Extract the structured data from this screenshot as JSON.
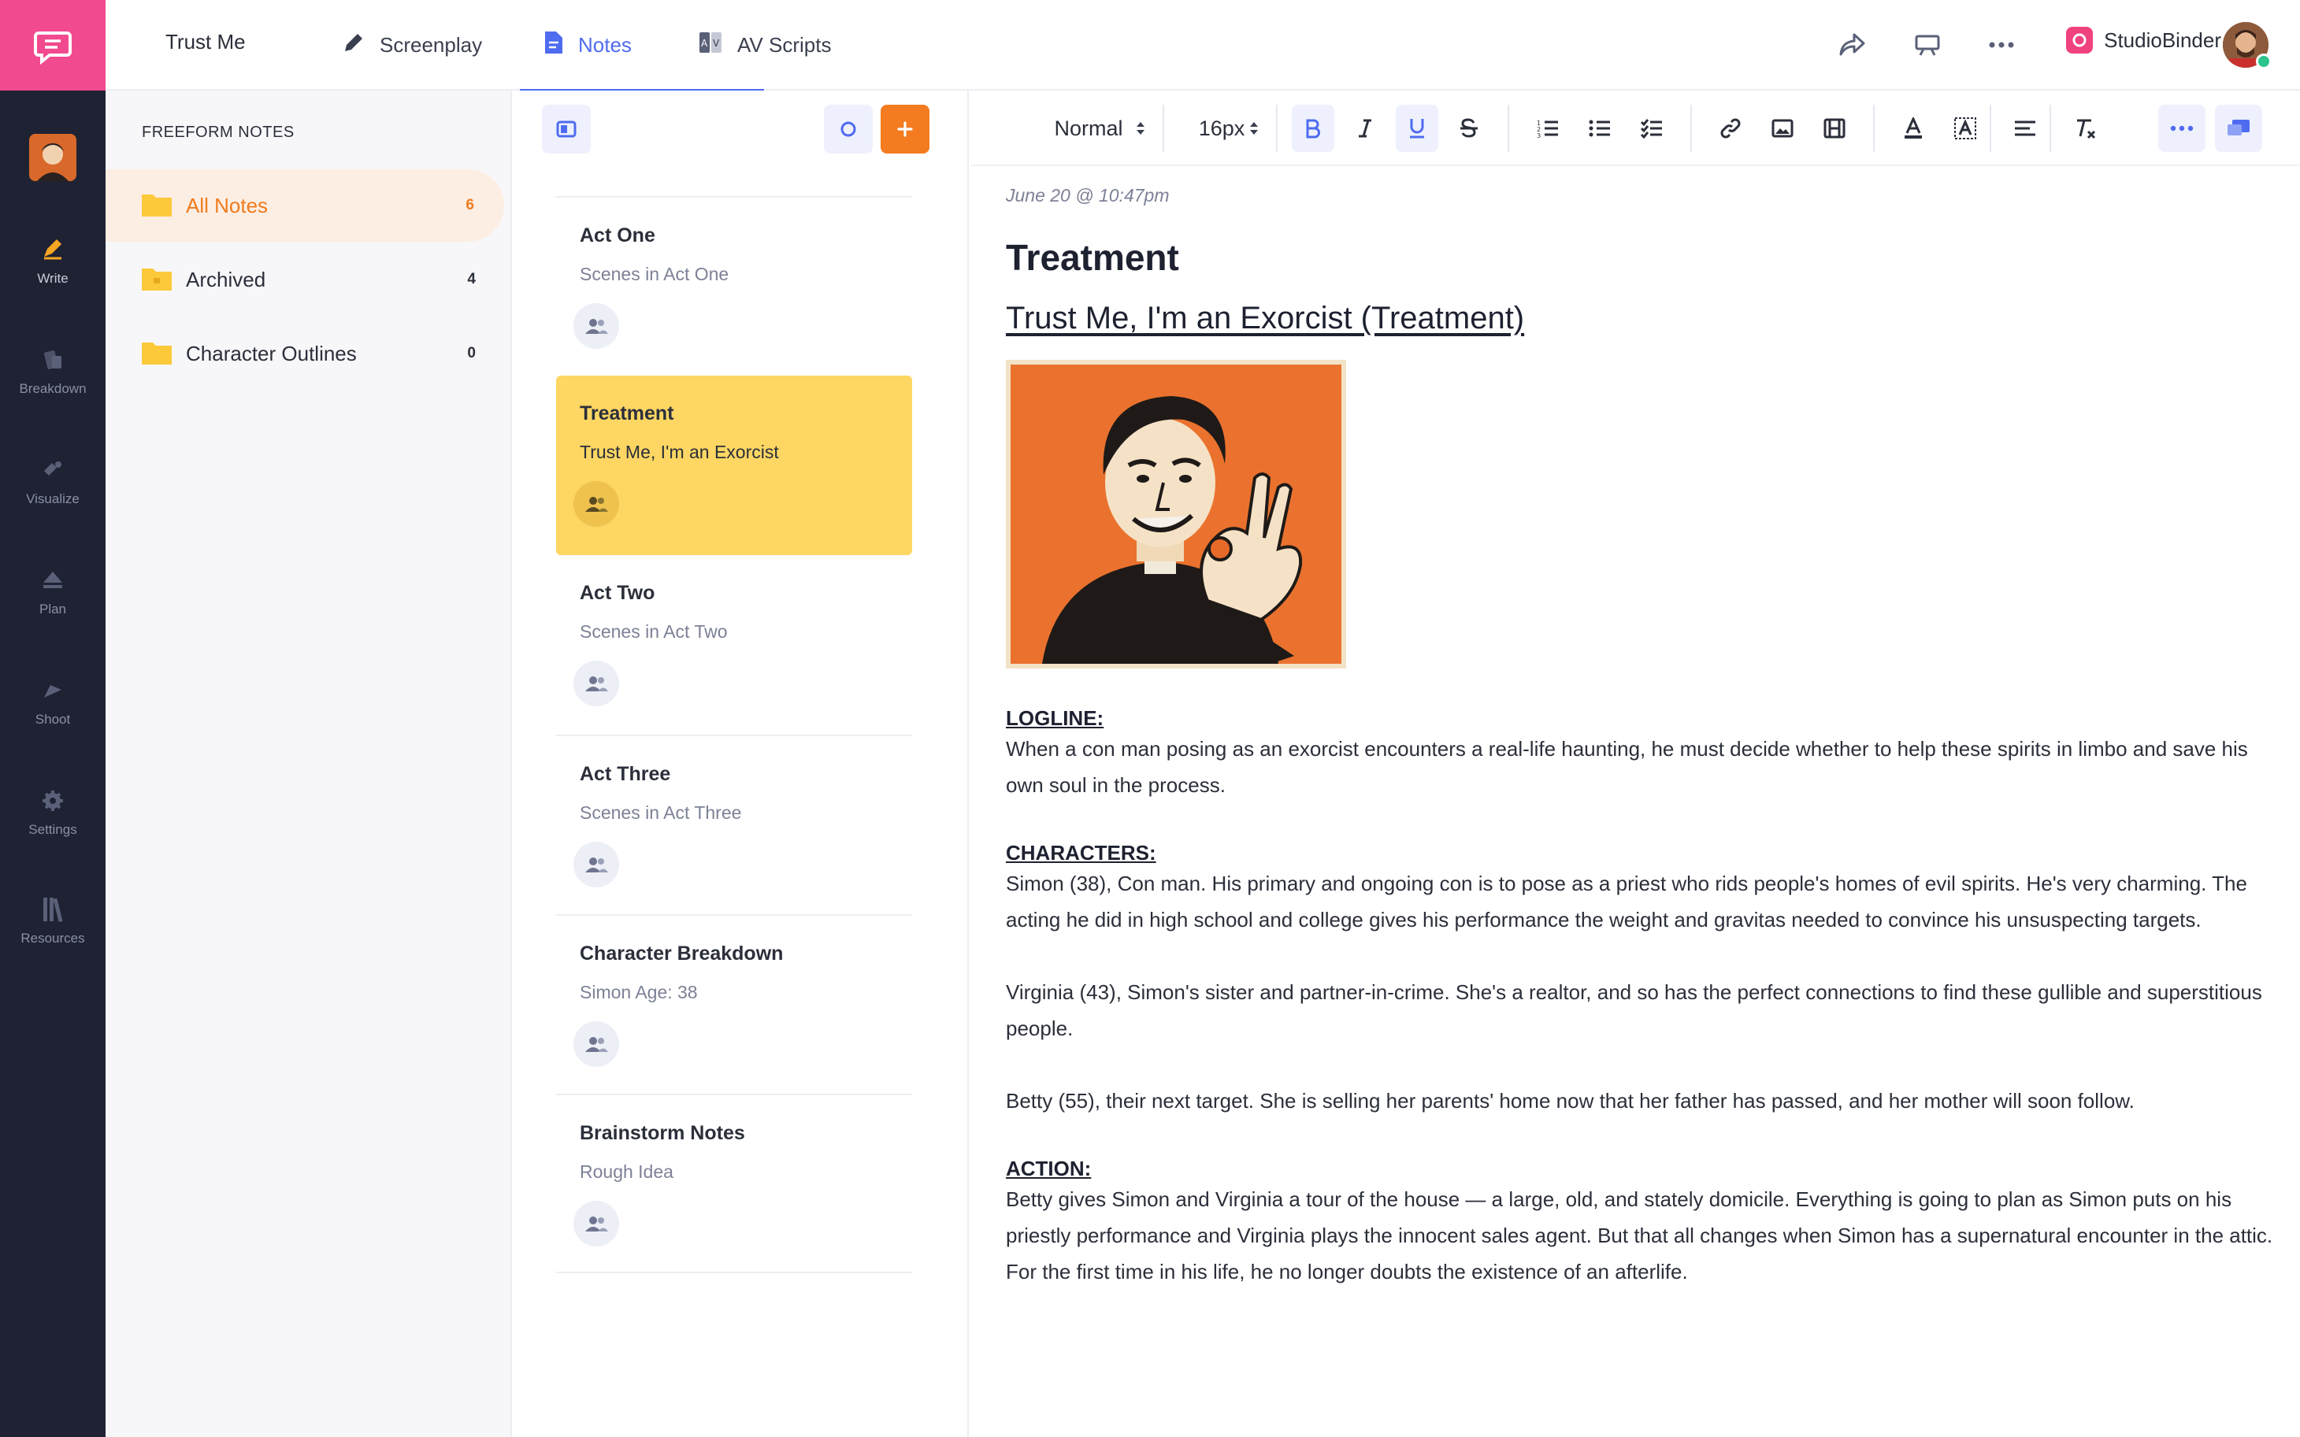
{
  "app": {
    "project_title": "Trust Me",
    "brand_name": "StudioBinder",
    "accent_color": "#4f6bf0",
    "logo_color": "#f24a8e"
  },
  "rail": {
    "items": [
      {
        "label": "Write",
        "icon": "pen-icon"
      },
      {
        "label": "Breakdown",
        "icon": "breakdown-icon"
      },
      {
        "label": "Visualize",
        "icon": "visualize-icon"
      },
      {
        "label": "Plan",
        "icon": "plan-icon"
      },
      {
        "label": "Shoot",
        "icon": "shoot-icon"
      },
      {
        "label": "Settings",
        "icon": "gear-icon"
      },
      {
        "label": "Resources",
        "icon": "books-icon"
      }
    ]
  },
  "tabs": [
    {
      "label": "Screenplay",
      "icon": "pencil-icon"
    },
    {
      "label": "Notes",
      "icon": "document-icon"
    },
    {
      "label": "AV Scripts",
      "icon": "av-script-icon"
    }
  ],
  "folders": {
    "heading": "FREEFORM NOTES",
    "items": [
      {
        "label": "All Notes",
        "count": "6"
      },
      {
        "label": "Archived",
        "count": "4"
      },
      {
        "label": "Character Outlines",
        "count": "0"
      }
    ]
  },
  "notes": [
    {
      "title": "Act One",
      "subtitle": "Scenes in Act One"
    },
    {
      "title": "Treatment",
      "subtitle": "Trust Me, I'm an Exorcist"
    },
    {
      "title": "Act Two",
      "subtitle": "Scenes in Act Two"
    },
    {
      "title": "Act Three",
      "subtitle": "Scenes in Act Three"
    },
    {
      "title": "Character Breakdown",
      "subtitle": "Simon Age: 38"
    },
    {
      "title": "Brainstorm Notes",
      "subtitle": "Rough Idea"
    }
  ],
  "toolbar": {
    "paragraph_style": "Normal",
    "font_size": "16px"
  },
  "document": {
    "date": "June 20 @ 10:47pm",
    "heading": "Treatment",
    "title": "Trust Me, I'm an Exorcist (Treatment)",
    "logline_label": "LOGLINE:",
    "logline": "When a con man posing as an exorcist encounters a real-life haunting, he must decide whether to help these spirits in limbo and save his own soul in the process.",
    "characters_label": "CHARACTERS:",
    "characters": [
      "Simon (38), Con man. His primary and ongoing con is to pose as a priest who rids people's homes of evil spirits. He's very charming. The acting he did in high school and college gives his performance the weight and gravitas needed to convince his unsuspecting targets.",
      "Virginia (43), Simon's sister and partner-in-crime. She's a realtor, and so has the perfect connections to find these gullible and superstitious people.",
      "Betty (55), their next target. She is selling her parents' home now that her father has passed, and her mother will soon follow."
    ],
    "action_label": "ACTION:",
    "action": "Betty gives Simon and Virginia a tour of the house — a large, old, and stately domicile. Everything is going to plan as Simon puts on his priestly performance and Virginia plays the innocent sales agent. But that all changes when Simon has a supernatural encounter in the attic. For the first time in his life, he no longer doubts the existence of an afterlife."
  }
}
